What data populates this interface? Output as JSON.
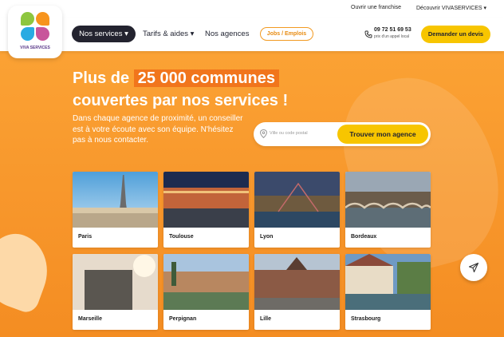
{
  "topbar": {
    "franchise": "Ouvrir une franchise",
    "discover": "Découvrir VIVASERVICES ▾"
  },
  "logo": {
    "text": "VIVA SERVICES"
  },
  "nav": {
    "services": "Nos services ▾",
    "tarifs": "Tarifs & aides ▾",
    "agences": "Nos agences",
    "jobs": "Jobs / Emplois",
    "phone": "09 72 51 69 53",
    "phone_sub": "prix d'un appel local",
    "devis": "Demander un devis"
  },
  "hero": {
    "title_prefix": "Plus de ",
    "title_highlight": "25 000 communes",
    "title_line2": "couvertes par nos services !",
    "description": "Dans chaque agence de proximité, un conseiller est à votre écoute avec son équipe. N'hésitez pas à nous contacter."
  },
  "search": {
    "placeholder": "Ville ou code postal",
    "button": "Trouver mon agence"
  },
  "cities": [
    {
      "name": "Paris"
    },
    {
      "name": "Toulouse"
    },
    {
      "name": "Lyon"
    },
    {
      "name": "Bordeaux"
    },
    {
      "name": "Marseille"
    },
    {
      "name": "Perpignan"
    },
    {
      "name": "Lille"
    },
    {
      "name": "Strasbourg"
    }
  ],
  "colors": {
    "orange": "#f7952a",
    "yellow": "#f7c500",
    "dark": "#23232f",
    "highlight": "#f1751c"
  },
  "icons": {
    "phone": "phone-icon",
    "pin": "location-pin-icon",
    "send": "paper-plane-icon"
  }
}
